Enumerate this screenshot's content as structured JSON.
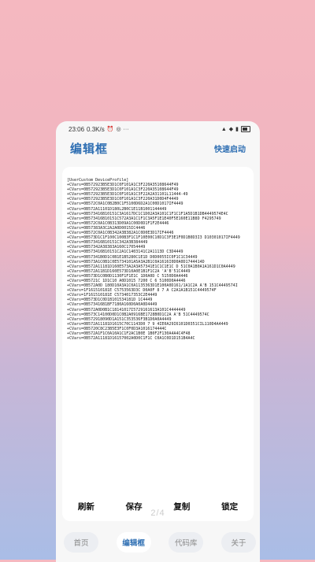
{
  "status": {
    "time": "23:06",
    "speed": "0.3K/s",
    "battery": ""
  },
  "appbar": {
    "title": "编辑框",
    "action": "快速启动"
  },
  "editor": {
    "content": "[UserCustom DeviceProfile]\n+CVars=0B572923B5E3D1C0F101A1C3F220A35108644F49\n+CVars=0B572923B5E3D1C0F101A1C3F220A35108644F49\n+CVars=0B572923B5E3D1C0F101A1C3F22A2A31101L11444-49\n+CVars=0B572923B5E3D1C0F101A1C3F220A31D0D4F4449\n+CVars=0B572C0A1C0B2B0C1F5100D6D2A1C00D1017IF4449\n+CVars=0B572A11101D180L2B0C1E11B1001144449\n+CVars=0B573416B10151C3A1617DC1C1D02A3A101C1F1C1F1A5D1B1DB4449574E4C\n+CVars=0B573416B10151C572A3A1C1F1C3A5F1E1E40F5E160E11B8D F4295749\n+CVars=0B572C0A1C0B313D09A1C00D0D1F1F2E4446\n+CVars=0B57383A3C2A2A0D0015IC4446\n+CVars=0B572C0A1C0B342A3B382A1C0D0E3D17IF4446\n+CVars=0B573D1C1F100C100B3F1C1F10E00C10D1C3F3E1F0D1B0D3I3 D10301017IF4449\n+CVars=0B573416B10151C342A3B384449\n+CVars=0B57342A38383A160C17054449\n+CVars=0B573416B10151C2A1C1403141C2A1113D C3D4449\n+CVars=0B57341B0D1C0B1E1B5280C1E1D D0D0055IC0F1C1C34449\n+CVars=0B573A1C0B1C0E5734101A5A3A2B1C0A1616I0D0A0D1744414D\n+CVars=0B572A11181D160E573A2A3A57341E1C1C1E1C D 51C0A1B0A1A161D1C0A4449\n+CVars=0B572A11B1D160E573D10A0E1B1F1C2A 'A'B'51C4449\n+CVars=0B573D1C0B0D1130F1F1E1C 1D0A0D C 5150D0A4446\n+CVars=0B5721C 1D1C10 A0D1015 7200 C 6 5100D0A4446\n+CVars=0B572A0D 180D10A3A1C0A1135363D1E100A0D161/1A1C2A A'B 151C4449574I\n+CVars=1F161510181E C5753563D3C D0A0F 8 7 A C2A1A1B151C4449574F\n+CVars=1F161510181E C5734017353C2E4449\n+CVars=0B573D1C0D1B101534181D 1C4449\n+CVars=0B573416B1BF7180A160D0A0A0D4449\n+CVars=0B572A0D0B1C18141017I5729161613A101C4444449\n+CVars=0B573C14100D0D1C0B2A0916BE1728B0D1C2A A'B 51C4449574C\n+CVars=0B572918090D1A151C353536F3B1D0A0A4449\n+CVars=0B572A11181D1615C70C1143D0 7 9 4IE0A29I6101D0351CIL110D4A4449\n+CVars=0B5720C8C23B5E3F1C0F0D3A1016174444C\n+CVars=0B572A1F1C0A10A1C1F2AC1B0E 1B0F2F130A4A4C4F48\n+CVars=0B572A11181D16157002A0D0C1F1C C0A1C0D1D151B4A4C"
  },
  "actions": [
    {
      "label": "刷新"
    },
    {
      "label": "保存"
    },
    {
      "label": "复制"
    },
    {
      "label": "锁定"
    }
  ],
  "pager": {
    "indicator": "2/4"
  },
  "nav": [
    {
      "label": "首页",
      "active": false
    },
    {
      "label": "编辑框",
      "active": true
    },
    {
      "label": "代码库",
      "active": false
    },
    {
      "label": "关于",
      "active": false
    }
  ]
}
